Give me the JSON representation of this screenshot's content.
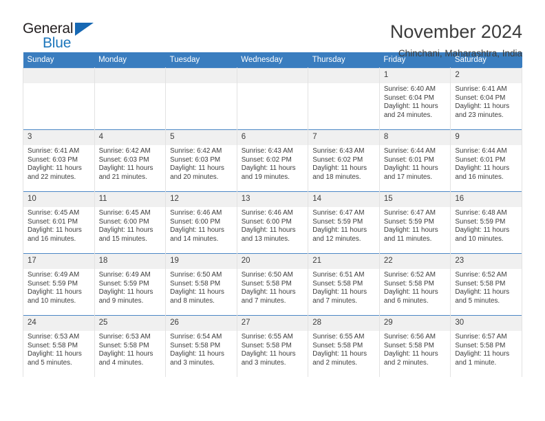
{
  "brand": {
    "name_part1": "General",
    "name_part2": "Blue",
    "triangle_icon": "triangle-icon",
    "accent_color": "#1b75bb"
  },
  "header": {
    "title": "November 2024",
    "subtitle": "Chinchani, Maharashtra, India"
  },
  "theme": {
    "header_bg": "#3a7dbf",
    "daynum_bg": "#f0f0f0",
    "row_border": "#4a86c5",
    "text": "#3c3c3c"
  },
  "weekdays": [
    "Sunday",
    "Monday",
    "Tuesday",
    "Wednesday",
    "Thursday",
    "Friday",
    "Saturday"
  ],
  "labels": {
    "sunrise_prefix": "Sunrise: ",
    "sunset_prefix": "Sunset: ",
    "daylight_prefix": "Daylight: "
  },
  "weeks": [
    [
      {
        "empty": true
      },
      {
        "empty": true
      },
      {
        "empty": true
      },
      {
        "empty": true
      },
      {
        "empty": true
      },
      {
        "day": "1",
        "sunrise": "Sunrise: 6:40 AM",
        "sunset": "Sunset: 6:04 PM",
        "daylight_line1": "Daylight: 11 hours",
        "daylight_line2": "and 24 minutes."
      },
      {
        "day": "2",
        "sunrise": "Sunrise: 6:41 AM",
        "sunset": "Sunset: 6:04 PM",
        "daylight_line1": "Daylight: 11 hours",
        "daylight_line2": "and 23 minutes."
      }
    ],
    [
      {
        "day": "3",
        "sunrise": "Sunrise: 6:41 AM",
        "sunset": "Sunset: 6:03 PM",
        "daylight_line1": "Daylight: 11 hours",
        "daylight_line2": "and 22 minutes."
      },
      {
        "day": "4",
        "sunrise": "Sunrise: 6:42 AM",
        "sunset": "Sunset: 6:03 PM",
        "daylight_line1": "Daylight: 11 hours",
        "daylight_line2": "and 21 minutes."
      },
      {
        "day": "5",
        "sunrise": "Sunrise: 6:42 AM",
        "sunset": "Sunset: 6:03 PM",
        "daylight_line1": "Daylight: 11 hours",
        "daylight_line2": "and 20 minutes."
      },
      {
        "day": "6",
        "sunrise": "Sunrise: 6:43 AM",
        "sunset": "Sunset: 6:02 PM",
        "daylight_line1": "Daylight: 11 hours",
        "daylight_line2": "and 19 minutes."
      },
      {
        "day": "7",
        "sunrise": "Sunrise: 6:43 AM",
        "sunset": "Sunset: 6:02 PM",
        "daylight_line1": "Daylight: 11 hours",
        "daylight_line2": "and 18 minutes."
      },
      {
        "day": "8",
        "sunrise": "Sunrise: 6:44 AM",
        "sunset": "Sunset: 6:01 PM",
        "daylight_line1": "Daylight: 11 hours",
        "daylight_line2": "and 17 minutes."
      },
      {
        "day": "9",
        "sunrise": "Sunrise: 6:44 AM",
        "sunset": "Sunset: 6:01 PM",
        "daylight_line1": "Daylight: 11 hours",
        "daylight_line2": "and 16 minutes."
      }
    ],
    [
      {
        "day": "10",
        "sunrise": "Sunrise: 6:45 AM",
        "sunset": "Sunset: 6:01 PM",
        "daylight_line1": "Daylight: 11 hours",
        "daylight_line2": "and 16 minutes."
      },
      {
        "day": "11",
        "sunrise": "Sunrise: 6:45 AM",
        "sunset": "Sunset: 6:00 PM",
        "daylight_line1": "Daylight: 11 hours",
        "daylight_line2": "and 15 minutes."
      },
      {
        "day": "12",
        "sunrise": "Sunrise: 6:46 AM",
        "sunset": "Sunset: 6:00 PM",
        "daylight_line1": "Daylight: 11 hours",
        "daylight_line2": "and 14 minutes."
      },
      {
        "day": "13",
        "sunrise": "Sunrise: 6:46 AM",
        "sunset": "Sunset: 6:00 PM",
        "daylight_line1": "Daylight: 11 hours",
        "daylight_line2": "and 13 minutes."
      },
      {
        "day": "14",
        "sunrise": "Sunrise: 6:47 AM",
        "sunset": "Sunset: 5:59 PM",
        "daylight_line1": "Daylight: 11 hours",
        "daylight_line2": "and 12 minutes."
      },
      {
        "day": "15",
        "sunrise": "Sunrise: 6:47 AM",
        "sunset": "Sunset: 5:59 PM",
        "daylight_line1": "Daylight: 11 hours",
        "daylight_line2": "and 11 minutes."
      },
      {
        "day": "16",
        "sunrise": "Sunrise: 6:48 AM",
        "sunset": "Sunset: 5:59 PM",
        "daylight_line1": "Daylight: 11 hours",
        "daylight_line2": "and 10 minutes."
      }
    ],
    [
      {
        "day": "17",
        "sunrise": "Sunrise: 6:49 AM",
        "sunset": "Sunset: 5:59 PM",
        "daylight_line1": "Daylight: 11 hours",
        "daylight_line2": "and 10 minutes."
      },
      {
        "day": "18",
        "sunrise": "Sunrise: 6:49 AM",
        "sunset": "Sunset: 5:59 PM",
        "daylight_line1": "Daylight: 11 hours",
        "daylight_line2": "and 9 minutes."
      },
      {
        "day": "19",
        "sunrise": "Sunrise: 6:50 AM",
        "sunset": "Sunset: 5:58 PM",
        "daylight_line1": "Daylight: 11 hours",
        "daylight_line2": "and 8 minutes."
      },
      {
        "day": "20",
        "sunrise": "Sunrise: 6:50 AM",
        "sunset": "Sunset: 5:58 PM",
        "daylight_line1": "Daylight: 11 hours",
        "daylight_line2": "and 7 minutes."
      },
      {
        "day": "21",
        "sunrise": "Sunrise: 6:51 AM",
        "sunset": "Sunset: 5:58 PM",
        "daylight_line1": "Daylight: 11 hours",
        "daylight_line2": "and 7 minutes."
      },
      {
        "day": "22",
        "sunrise": "Sunrise: 6:52 AM",
        "sunset": "Sunset: 5:58 PM",
        "daylight_line1": "Daylight: 11 hours",
        "daylight_line2": "and 6 minutes."
      },
      {
        "day": "23",
        "sunrise": "Sunrise: 6:52 AM",
        "sunset": "Sunset: 5:58 PM",
        "daylight_line1": "Daylight: 11 hours",
        "daylight_line2": "and 5 minutes."
      }
    ],
    [
      {
        "day": "24",
        "sunrise": "Sunrise: 6:53 AM",
        "sunset": "Sunset: 5:58 PM",
        "daylight_line1": "Daylight: 11 hours",
        "daylight_line2": "and 5 minutes."
      },
      {
        "day": "25",
        "sunrise": "Sunrise: 6:53 AM",
        "sunset": "Sunset: 5:58 PM",
        "daylight_line1": "Daylight: 11 hours",
        "daylight_line2": "and 4 minutes."
      },
      {
        "day": "26",
        "sunrise": "Sunrise: 6:54 AM",
        "sunset": "Sunset: 5:58 PM",
        "daylight_line1": "Daylight: 11 hours",
        "daylight_line2": "and 3 minutes."
      },
      {
        "day": "27",
        "sunrise": "Sunrise: 6:55 AM",
        "sunset": "Sunset: 5:58 PM",
        "daylight_line1": "Daylight: 11 hours",
        "daylight_line2": "and 3 minutes."
      },
      {
        "day": "28",
        "sunrise": "Sunrise: 6:55 AM",
        "sunset": "Sunset: 5:58 PM",
        "daylight_line1": "Daylight: 11 hours",
        "daylight_line2": "and 2 minutes."
      },
      {
        "day": "29",
        "sunrise": "Sunrise: 6:56 AM",
        "sunset": "Sunset: 5:58 PM",
        "daylight_line1": "Daylight: 11 hours",
        "daylight_line2": "and 2 minutes."
      },
      {
        "day": "30",
        "sunrise": "Sunrise: 6:57 AM",
        "sunset": "Sunset: 5:58 PM",
        "daylight_line1": "Daylight: 11 hours",
        "daylight_line2": "and 1 minute."
      }
    ]
  ]
}
